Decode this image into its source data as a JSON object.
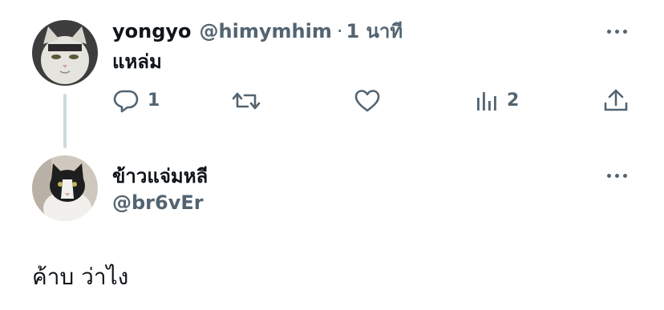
{
  "tweet": {
    "author_name": "yongyo",
    "author_handle": "@himymhim",
    "separator": "·",
    "time": "1 นาที",
    "text": "แหล่ม",
    "more_icon": "more-horizontal-icon",
    "actions": {
      "reply": {
        "icon": "reply-icon",
        "count": "1"
      },
      "retweet": {
        "icon": "retweet-icon",
        "count": ""
      },
      "like": {
        "icon": "heart-icon",
        "count": ""
      },
      "views": {
        "icon": "views-chart-icon",
        "count": "2"
      },
      "share": {
        "icon": "share-icon",
        "count": ""
      }
    }
  },
  "reply_author": {
    "name": "ข้าวแจ่มหลี",
    "handle": "@br6vEr",
    "more_icon": "more-horizontal-icon"
  },
  "compose": {
    "text": "ค้าบ ว่าไง"
  },
  "colors": {
    "text_primary": "#0f1419",
    "text_secondary": "#536471",
    "thread_line": "#cfd9de",
    "background": "#ffffff"
  }
}
